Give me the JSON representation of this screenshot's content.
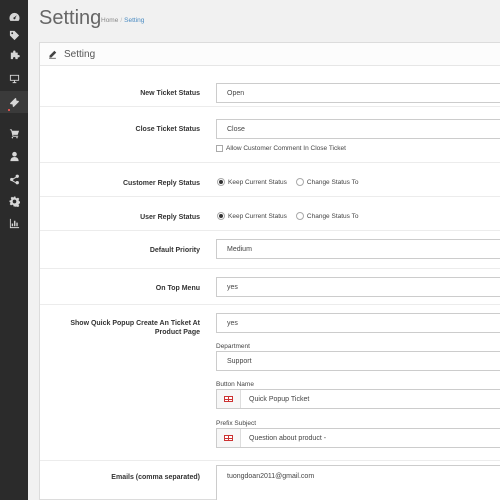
{
  "sidebar": {
    "items": [
      {
        "icon": "dashboard-icon"
      },
      {
        "icon": "tags-icon"
      },
      {
        "icon": "puzzle-icon"
      },
      {
        "icon": "desktop-icon"
      },
      {
        "icon": "ticket-icon",
        "active": true
      },
      {
        "icon": "cart-icon"
      },
      {
        "icon": "user-icon"
      },
      {
        "icon": "share-icon"
      },
      {
        "icon": "gear-icon"
      },
      {
        "icon": "bar-chart-icon"
      }
    ]
  },
  "header": {
    "title": "Setting",
    "breadcrumb": {
      "home": "Home",
      "separator": "/",
      "current": "Setting"
    }
  },
  "panel": {
    "title": "Setting"
  },
  "form": {
    "new_ticket_status": {
      "label": "New Ticket Status",
      "value": "Open"
    },
    "close_ticket_status": {
      "label": "Close Ticket Status",
      "value": "Close",
      "checkbox_label": "Allow Customer Comment In Close Ticket"
    },
    "customer_reply_status": {
      "label": "Customer Reply Status",
      "option_keep": "Keep Current Status",
      "option_change": "Change Status To"
    },
    "user_reply_status": {
      "label": "User Reply Status",
      "option_keep": "Keep Current Status",
      "option_change": "Change Status To"
    },
    "default_priority": {
      "label": "Default Priority",
      "value": "Medium"
    },
    "on_top_menu": {
      "label": "On Top Menu",
      "value": "yes"
    },
    "quick_popup": {
      "label_line1": "Show Quick Popup Create An Ticket At",
      "label_line2": "Product Page",
      "value": "yes",
      "department_label": "Department",
      "department_value": "Support",
      "button_name_label": "Button Name",
      "button_name_value": "Quick Popup Ticket",
      "prefix_subject_label": "Prefix Subject",
      "prefix_subject_value": "Question about product -"
    },
    "emails": {
      "label": "Emails (comma separated)",
      "value": "tuongdoan2011@gmail.com"
    }
  }
}
